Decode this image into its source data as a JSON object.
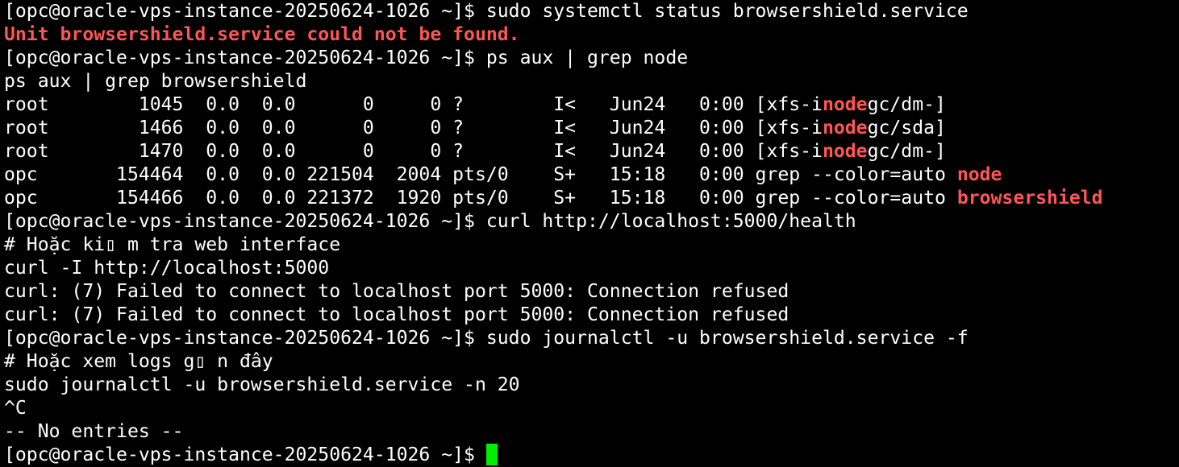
{
  "window": {
    "theme": {
      "background": "#000000",
      "foreground": "#ffffff",
      "highlight": "#ff5555",
      "cursor": "#00ee00"
    }
  },
  "terminal": {
    "prompt": "[opc@oracle-vps-instance-20250624-1026 ~]$ ",
    "lines": {
      "l1_cmd": "sudo systemctl status browsershield.service",
      "l2_error": "Unit browsershield.service could not be found.",
      "l3_cmd": "ps aux | grep node",
      "l4": "ps aux | grep browsershield",
      "l5_pre": "root        1045  0.0  0.0      0     0 ?        I<   Jun24   0:00 [xfs-i",
      "l5_hl": "node",
      "l5_post": "gc/dm-]",
      "l6_pre": "root        1466  0.0  0.0      0     0 ?        I<   Jun24   0:00 [xfs-i",
      "l6_hl": "node",
      "l6_post": "gc/sda]",
      "l7_pre": "root        1470  0.0  0.0      0     0 ?        I<   Jun24   0:00 [xfs-i",
      "l7_hl": "node",
      "l7_post": "gc/dm-]",
      "l8_pre": "opc       154464  0.0  0.0 221504  2004 pts/0    S+   15:18   0:00 grep --color=auto ",
      "l8_hl": "node",
      "l9_pre": "opc       154466  0.0  0.0 221372  1920 pts/0    S+   15:18   0:00 grep --color=auto ",
      "l9_hl": "browsershield",
      "l10_cmd": "curl http://localhost:5000/health",
      "l11": "# Hoặc ki▯ m tra web interface",
      "l12": "curl -I http://localhost:5000",
      "l13": "curl: (7) Failed to connect to localhost port 5000: Connection refused",
      "l14": "curl: (7) Failed to connect to localhost port 5000: Connection refused",
      "l15_cmd": "sudo journalctl -u browsershield.service -f",
      "l16": "# Hoặc xem logs g▯ n đây",
      "l17": "sudo journalctl -u browsershield.service -n 20",
      "l18": "^C",
      "l19": "-- No entries --"
    }
  }
}
